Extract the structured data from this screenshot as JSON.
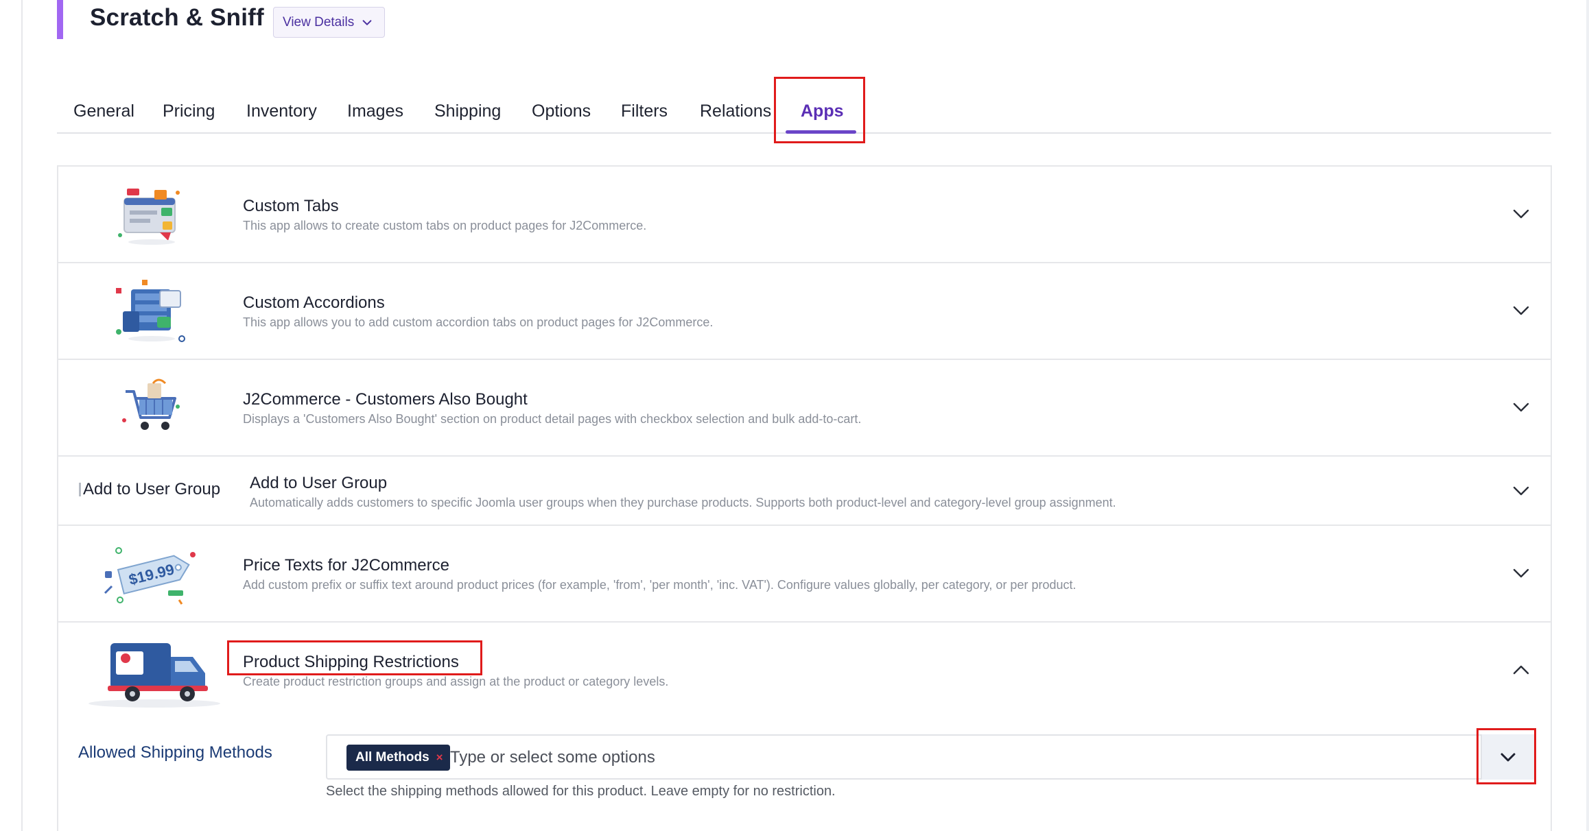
{
  "product": {
    "title": "Scratch & Sniff",
    "view_details_label": "View Details"
  },
  "tabs": [
    {
      "label": "General"
    },
    {
      "label": "Pricing"
    },
    {
      "label": "Inventory"
    },
    {
      "label": "Images"
    },
    {
      "label": "Shipping"
    },
    {
      "label": "Options"
    },
    {
      "label": "Filters"
    },
    {
      "label": "Relations"
    },
    {
      "label": "Apps",
      "active": true
    }
  ],
  "apps": [
    {
      "title": "Custom Tabs",
      "description": "This app allows to create custom tabs on product pages for J2Commerce.",
      "icon": "custom-tabs-icon",
      "expanded": false
    },
    {
      "title": "Custom Accordions",
      "description": "This app allows you to add custom accordion tabs on product pages for J2Commerce.",
      "icon": "accordion-icon",
      "expanded": false
    },
    {
      "title": "J2Commerce - Customers Also Bought",
      "description": "Displays a 'Customers Also Bought' section on product detail pages with checkbox selection and bulk add-to-cart.",
      "icon": "shopping-cart-icon",
      "expanded": false
    },
    {
      "title": "Add to User Group",
      "description": "Automatically adds customers to specific Joomla user groups when they purchase products. Supports both product-level and category-level group assignment.",
      "image_alt": "Add to User Group",
      "expanded": false
    },
    {
      "title": "Price Texts for J2Commerce",
      "description": "Add custom prefix or suffix text around product prices (for example, 'from', 'per month', 'inc. VAT'). Configure values globally, per category, or per product.",
      "icon": "price-tag-icon",
      "price_tag_text": "$19.99",
      "expanded": false
    },
    {
      "title": "Product Shipping Restrictions",
      "description": "Create product restriction groups and assign at the product or category levels.",
      "icon": "delivery-truck-icon",
      "expanded": true
    }
  ],
  "shipping_restrictions": {
    "label": "Allowed Shipping Methods",
    "selected": [
      "All Methods"
    ],
    "placeholder": "Type or select some options",
    "help": "Select the shipping methods allowed for this product. Leave empty for no restriction."
  },
  "colors": {
    "accent": "#6a45c8",
    "header_bar": "#a167f2",
    "highlight_box": "#e01b1b",
    "tag_bg": "#1b2a4a"
  }
}
